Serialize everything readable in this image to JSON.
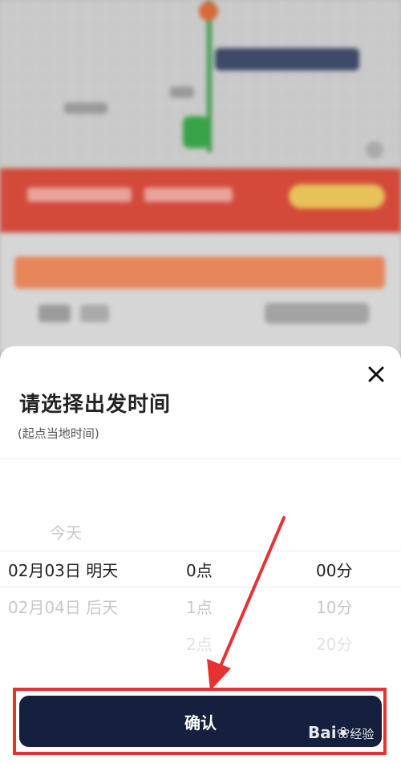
{
  "sheet": {
    "title": "请选择出发时间",
    "subtitle": "(起点当地时间)",
    "close_icon": "close-icon"
  },
  "picker": {
    "date_column": [
      "今天",
      "02月03日  明天",
      "02月04日  后天"
    ],
    "hour_column": [
      "0点",
      "1点",
      "2点"
    ],
    "minute_column": [
      "00分",
      "10分",
      "20分"
    ],
    "selected": {
      "date": "02月03日  明天",
      "hour": "0点",
      "minute": "00分"
    }
  },
  "confirm": {
    "label": "确认"
  },
  "watermark": {
    "text": "Bai",
    "suffix": "经验"
  },
  "colors": {
    "confirm_bg": "#14203e",
    "annotation": "#e63232"
  }
}
